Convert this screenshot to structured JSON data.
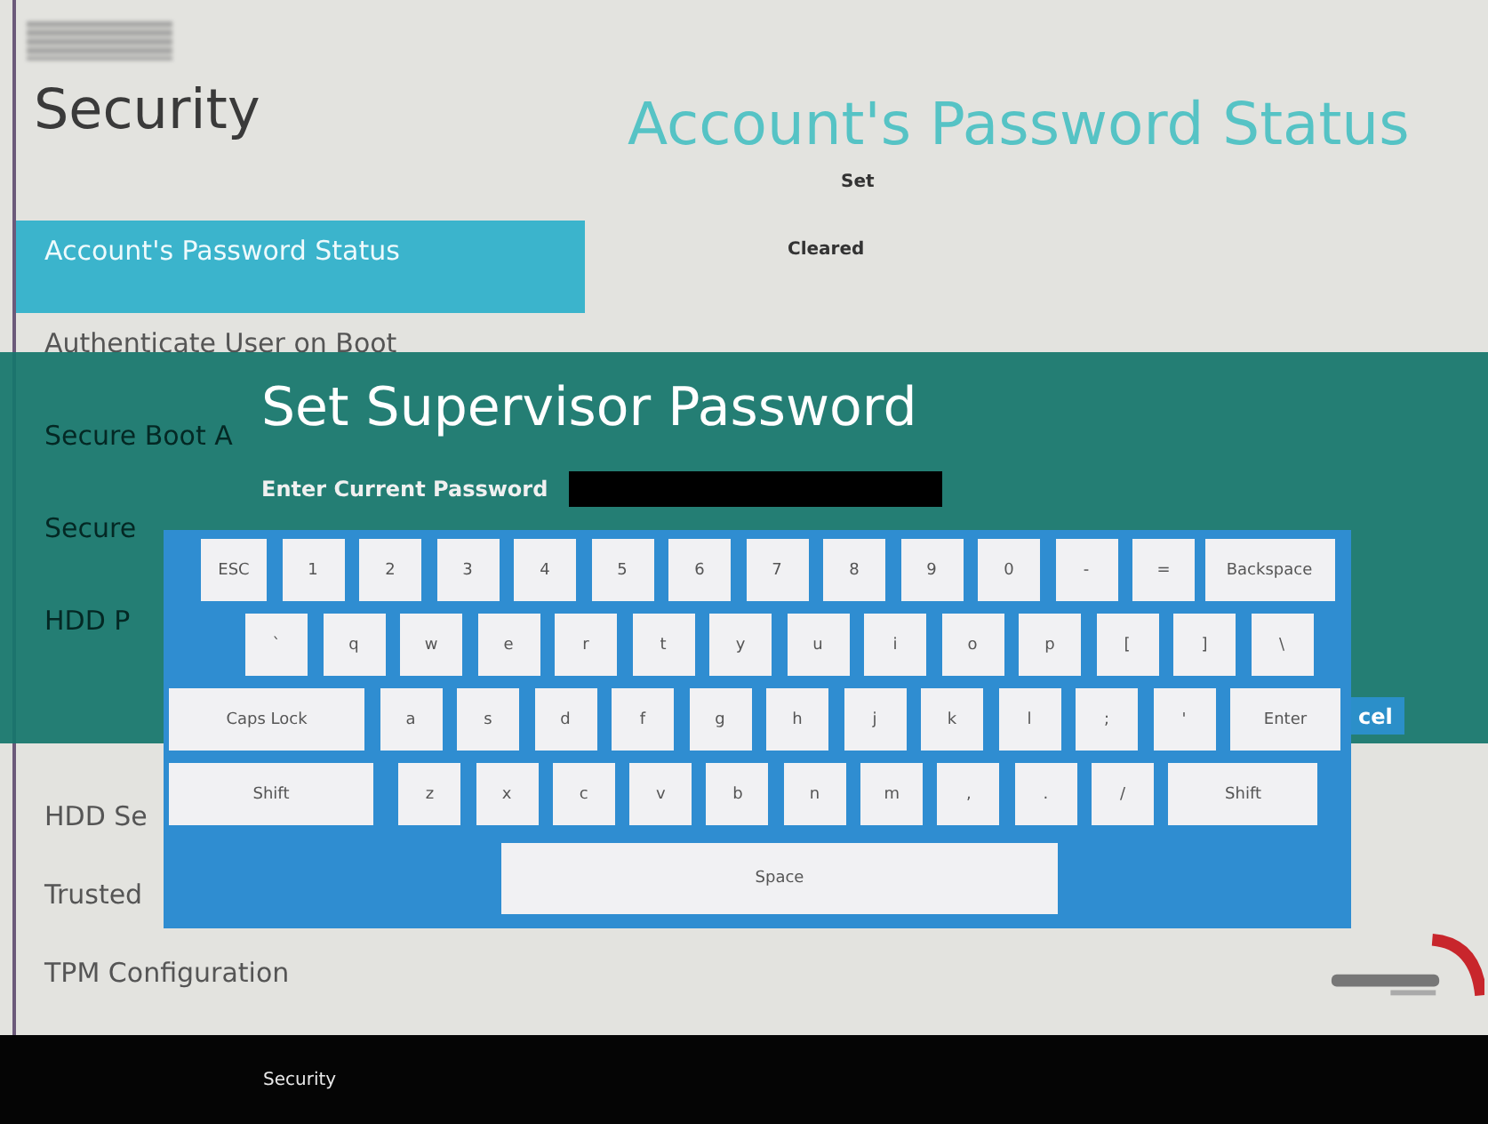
{
  "sidebar": {
    "title": "Security",
    "items": [
      {
        "label": "Account's Password Status",
        "selected": true
      },
      {
        "label": "Authenticate User on Boot",
        "selected": false
      },
      {
        "label": "Secure Boot A",
        "selected": false
      },
      {
        "label": "Secure",
        "selected": false
      },
      {
        "label": "HDD P",
        "selected": false
      },
      {
        "label": "HDD Se",
        "selected": false
      },
      {
        "label": "Trusted",
        "selected": false
      },
      {
        "label": "TPM Configuration",
        "selected": false
      }
    ]
  },
  "content": {
    "title": "Account's Password Status",
    "rows": [
      {
        "value": "Set"
      },
      {
        "value": "Cleared"
      }
    ]
  },
  "dialog": {
    "title": "Set Supervisor Password",
    "field_label": "Enter Current Password",
    "cancel_button": "cel"
  },
  "keyboard": {
    "rows": [
      {
        "keys": [
          {
            "label": "ESC",
            "kind": "esc"
          },
          {
            "label": "1",
            "kind": "char"
          },
          {
            "label": "2",
            "kind": "char"
          },
          {
            "label": "3",
            "kind": "char"
          },
          {
            "label": "4",
            "kind": "char"
          },
          {
            "label": "5",
            "kind": "char"
          },
          {
            "label": "6",
            "kind": "char"
          },
          {
            "label": "7",
            "kind": "char"
          },
          {
            "label": "8",
            "kind": "char"
          },
          {
            "label": "9",
            "kind": "char"
          },
          {
            "label": "0",
            "kind": "char"
          },
          {
            "label": "-",
            "kind": "char"
          },
          {
            "label": "=",
            "kind": "char"
          },
          {
            "label": "Backspace",
            "kind": "backspace"
          }
        ]
      },
      {
        "keys": [
          {
            "label": "`",
            "kind": "char"
          },
          {
            "label": "q",
            "kind": "char"
          },
          {
            "label": "w",
            "kind": "char"
          },
          {
            "label": "e",
            "kind": "char"
          },
          {
            "label": "r",
            "kind": "char"
          },
          {
            "label": "t",
            "kind": "char"
          },
          {
            "label": "y",
            "kind": "char"
          },
          {
            "label": "u",
            "kind": "char"
          },
          {
            "label": "i",
            "kind": "char"
          },
          {
            "label": "o",
            "kind": "char"
          },
          {
            "label": "p",
            "kind": "char"
          },
          {
            "label": "[",
            "kind": "char"
          },
          {
            "label": "]",
            "kind": "char"
          },
          {
            "label": "\\",
            "kind": "char"
          }
        ]
      },
      {
        "keys": [
          {
            "label": "Caps Lock",
            "kind": "caps"
          },
          {
            "label": "a",
            "kind": "char"
          },
          {
            "label": "s",
            "kind": "char"
          },
          {
            "label": "d",
            "kind": "char"
          },
          {
            "label": "f",
            "kind": "char"
          },
          {
            "label": "g",
            "kind": "char"
          },
          {
            "label": "h",
            "kind": "char"
          },
          {
            "label": "j",
            "kind": "char"
          },
          {
            "label": "k",
            "kind": "char"
          },
          {
            "label": "l",
            "kind": "char"
          },
          {
            "label": ";",
            "kind": "char"
          },
          {
            "label": "'",
            "kind": "char"
          },
          {
            "label": "Enter",
            "kind": "enter"
          }
        ]
      },
      {
        "keys": [
          {
            "label": "Shift",
            "kind": "lshift"
          },
          {
            "label": "z",
            "kind": "char"
          },
          {
            "label": "x",
            "kind": "char"
          },
          {
            "label": "c",
            "kind": "char"
          },
          {
            "label": "v",
            "kind": "char"
          },
          {
            "label": "b",
            "kind": "char"
          },
          {
            "label": "n",
            "kind": "char"
          },
          {
            "label": "m",
            "kind": "char"
          },
          {
            "label": ",",
            "kind": "char"
          },
          {
            "label": ".",
            "kind": "char"
          },
          {
            "label": "/",
            "kind": "char"
          },
          {
            "label": "Shift",
            "kind": "rshift"
          }
        ]
      },
      {
        "keys": [
          {
            "label": "Space",
            "kind": "space"
          }
        ]
      }
    ]
  },
  "bottom_bar": {
    "tab": "Security"
  }
}
